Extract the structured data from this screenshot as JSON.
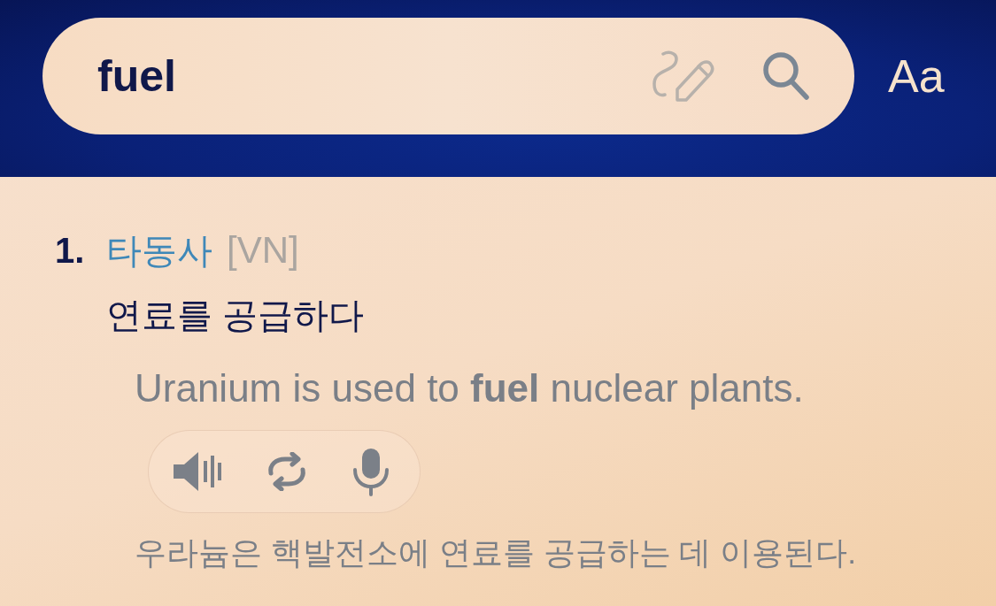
{
  "search": {
    "value": "fuel"
  },
  "font_button": {
    "label": "Aa"
  },
  "senses": [
    {
      "number": "1.",
      "part_of_speech": "타동사",
      "pattern": "[VN]",
      "meaning": "연료를 공급하다",
      "examples": [
        {
          "text": "Uranium is used to **fuel** nuclear plants.",
          "translation": "우라늄은 핵발전소에 연료를 공급하는 데 이용된다."
        }
      ]
    }
  ]
}
